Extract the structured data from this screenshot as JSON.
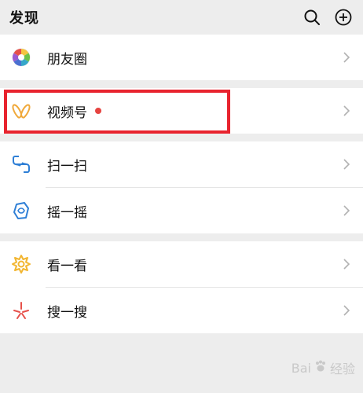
{
  "header": {
    "title": "发现",
    "search_icon": "search-icon",
    "add_icon": "plus-circle-icon"
  },
  "menu": {
    "moments": {
      "label": "朋友圈",
      "icon": "moments-aperture-icon"
    },
    "channels": {
      "label": "视频号",
      "icon": "channels-butterfly-icon",
      "badge_color": "#e64340"
    },
    "scan": {
      "label": "扫一扫",
      "icon": "scan-icon"
    },
    "shake": {
      "label": "摇一摇",
      "icon": "shake-icon"
    },
    "top_stories": {
      "label": "看一看",
      "icon": "top-stories-icon"
    },
    "search": {
      "label": "搜一搜",
      "icon": "search-spark-icon"
    }
  },
  "highlight_color": "#e8232e",
  "watermark": {
    "text_1": "Bai",
    "text_2": "经验"
  }
}
